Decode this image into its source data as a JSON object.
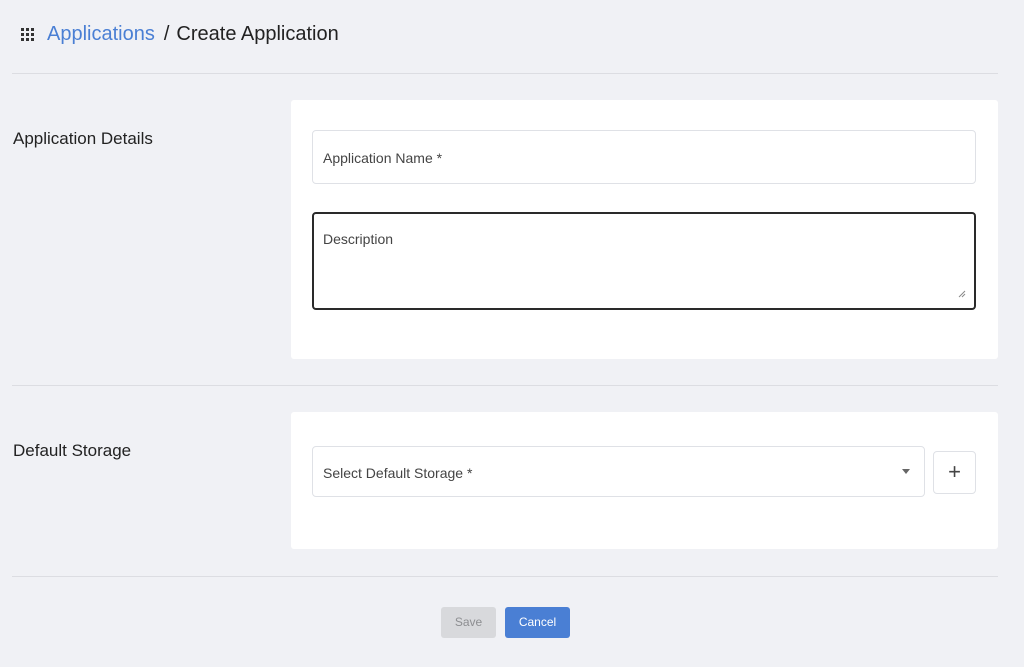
{
  "header": {
    "icon": "apps-grid-icon",
    "breadcrumb_link": "Applications",
    "breadcrumb_separator": "/",
    "breadcrumb_current": "Create Application"
  },
  "application_details": {
    "section_label": "Application Details",
    "name_placeholder": "Application Name *",
    "description_placeholder": "Description"
  },
  "default_storage": {
    "section_label": "Default Storage",
    "select_placeholder": "Select Default Storage *",
    "add_label": "+"
  },
  "actions": {
    "save_label": "Save",
    "cancel_label": "Cancel"
  },
  "colors": {
    "accent": "#4a7fd4",
    "background": "#f0f1f5",
    "card": "#ffffff"
  }
}
